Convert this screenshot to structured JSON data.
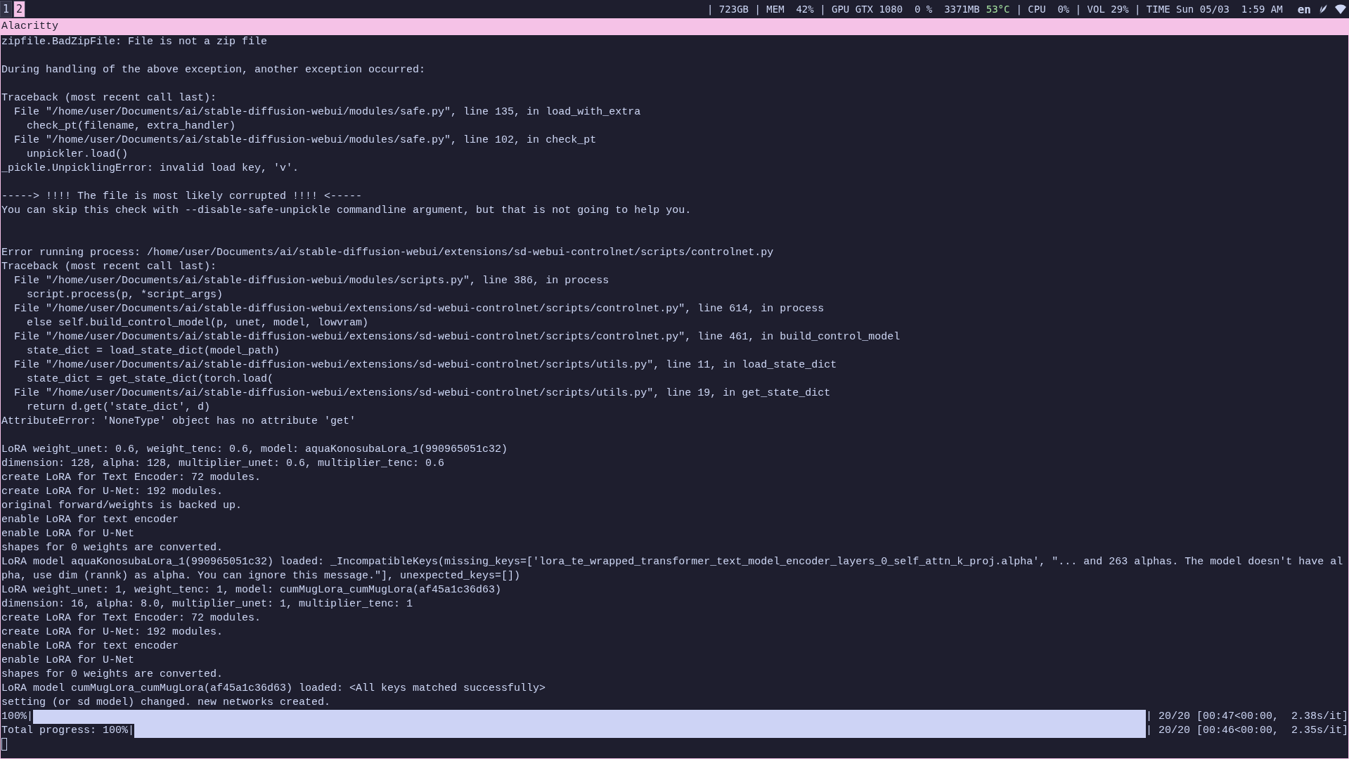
{
  "workspaces": [
    {
      "label": "1",
      "selected": false
    },
    {
      "label": "2",
      "selected": true
    }
  ],
  "status_bar": [
    {
      "text": "| 723GB | MEM  42% | GPU GTX 1080  0 %  3371MB",
      "kind": "normal"
    },
    {
      "text": "53°C",
      "kind": "good"
    },
    {
      "text": "| CPU  0% | VOL 29% | TIME Sun 05/03  1:59 AM",
      "kind": "normal"
    }
  ],
  "keyboard_layout": "en",
  "window": {
    "title": "Alacritty"
  },
  "terminal": {
    "lines": [
      {
        "text": "zipfile.BadZipFile: File is not a zip file"
      },
      {
        "kind": "blank"
      },
      {
        "text": "During handling of the above exception, another exception occurred:"
      },
      {
        "kind": "blank"
      },
      {
        "text": "Traceback (most recent call last):"
      },
      {
        "text": "  File \"/home/user/Documents/ai/stable-diffusion-webui/modules/safe.py\", line 135, in load_with_extra"
      },
      {
        "text": "    check_pt(filename, extra_handler)"
      },
      {
        "text": "  File \"/home/user/Documents/ai/stable-diffusion-webui/modules/safe.py\", line 102, in check_pt"
      },
      {
        "text": "    unpickler.load()"
      },
      {
        "text": "_pickle.UnpicklingError: invalid load key, 'v'."
      },
      {
        "kind": "blank"
      },
      {
        "text": "-----> !!!! The file is most likely corrupted !!!! <-----"
      },
      {
        "text": "You can skip this check with --disable-safe-unpickle commandline argument, but that is not going to help you."
      },
      {
        "kind": "blank"
      },
      {
        "kind": "blank"
      },
      {
        "text": "Error running process: /home/user/Documents/ai/stable-diffusion-webui/extensions/sd-webui-controlnet/scripts/controlnet.py"
      },
      {
        "text": "Traceback (most recent call last):"
      },
      {
        "text": "  File \"/home/user/Documents/ai/stable-diffusion-webui/modules/scripts.py\", line 386, in process"
      },
      {
        "text": "    script.process(p, *script_args)"
      },
      {
        "text": "  File \"/home/user/Documents/ai/stable-diffusion-webui/extensions/sd-webui-controlnet/scripts/controlnet.py\", line 614, in process"
      },
      {
        "text": "    else self.build_control_model(p, unet, model, lowvram)"
      },
      {
        "text": "  File \"/home/user/Documents/ai/stable-diffusion-webui/extensions/sd-webui-controlnet/scripts/controlnet.py\", line 461, in build_control_model"
      },
      {
        "text": "    state_dict = load_state_dict(model_path)"
      },
      {
        "text": "  File \"/home/user/Documents/ai/stable-diffusion-webui/extensions/sd-webui-controlnet/scripts/utils.py\", line 11, in load_state_dict"
      },
      {
        "text": "    state_dict = get_state_dict(torch.load("
      },
      {
        "text": "  File \"/home/user/Documents/ai/stable-diffusion-webui/extensions/sd-webui-controlnet/scripts/utils.py\", line 19, in get_state_dict"
      },
      {
        "text": "    return d.get('state_dict', d)"
      },
      {
        "text": "AttributeError: 'NoneType' object has no attribute 'get'"
      },
      {
        "kind": "blank"
      },
      {
        "text": "LoRA weight_unet: 0.6, weight_tenc: 0.6, model: aquaKonosubaLora_1(990965051c32)"
      },
      {
        "text": "dimension: 128, alpha: 128, multiplier_unet: 0.6, multiplier_tenc: 0.6"
      },
      {
        "text": "create LoRA for Text Encoder: 72 modules."
      },
      {
        "text": "create LoRA for U-Net: 192 modules."
      },
      {
        "text": "original forward/weights is backed up."
      },
      {
        "text": "enable LoRA for text encoder"
      },
      {
        "text": "enable LoRA for U-Net"
      },
      {
        "text": "shapes for 0 weights are converted."
      },
      {
        "text": "LoRA model aquaKonosubaLora_1(990965051c32) loaded: _IncompatibleKeys(missing_keys=['lora_te_wrapped_transformer_text_model_encoder_layers_0_self_attn_k_proj.alpha', \"... and 263 alphas. The model doesn't have al"
      },
      {
        "text": "pha, use dim (rannk) as alpha. You can ignore this message.\"], unexpected_keys=[])"
      },
      {
        "text": "LoRA weight_unet: 1, weight_tenc: 1, model: cumMugLora_cumMugLora(af45a1c36d63)"
      },
      {
        "text": "dimension: 16, alpha: 8.0, multiplier_unet: 1, multiplier_tenc: 1"
      },
      {
        "text": "create LoRA for Text Encoder: 72 modules."
      },
      {
        "text": "create LoRA for U-Net: 192 modules."
      },
      {
        "text": "enable LoRA for text encoder"
      },
      {
        "text": "enable LoRA for U-Net"
      },
      {
        "text": "shapes for 0 weights are converted."
      },
      {
        "text": "LoRA model cumMugLora_cumMugLora(af45a1c36d63) loaded: <All keys matched successfully>"
      },
      {
        "text": "setting (or sd model) changed. new networks created."
      }
    ],
    "progress": [
      {
        "label": "100%|",
        "level": 1,
        "stats": "| 20/20 [00:47<00:00,  2.38s/it]"
      },
      {
        "label": "Total progress: 100%|",
        "level": 1,
        "stats": "| 20/20 [00:46<00:00,  2.35s/it]"
      }
    ]
  }
}
